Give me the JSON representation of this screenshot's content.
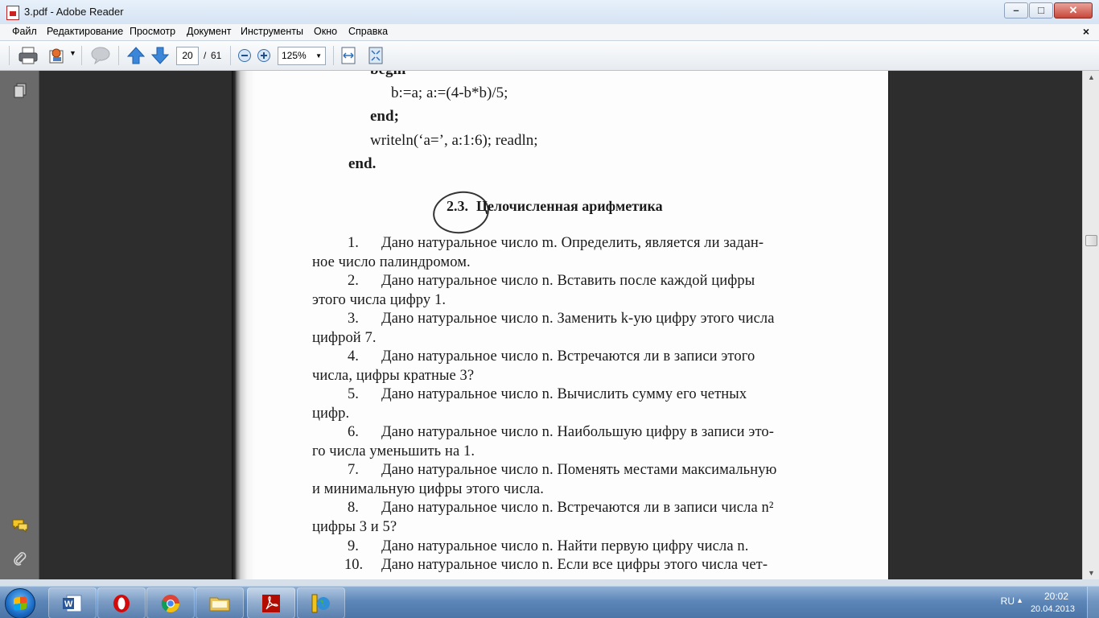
{
  "window": {
    "title": "3.pdf - Adobe Reader",
    "minimize": "–",
    "maximize": "□",
    "close": "✕"
  },
  "menu": {
    "items": [
      "Файл",
      "Редактирование",
      "Просмотр",
      "Документ",
      "Инструменты",
      "Окно",
      "Справка"
    ],
    "close_doc": "×"
  },
  "toolbar": {
    "current_page": "20",
    "page_separator": "/",
    "total_pages": "61",
    "zoom": "125%"
  },
  "document": {
    "code_lines": [
      "begin",
      "b:=a; a:=(4-b*b)/5;",
      "end;",
      "writeln(‘a=’, a:1:6); readln;",
      "end."
    ],
    "section_number": "2.3.",
    "section_title": "Целочисленная арифметика",
    "tasks": [
      {
        "num": "1.",
        "lines": [
          "Дано натуральное число m. Определить, является ли задан-",
          "ное число палиндромом."
        ]
      },
      {
        "num": "2.",
        "lines": [
          "Дано натуральное число n. Вставить после каждой цифры",
          "этого числа цифру 1."
        ]
      },
      {
        "num": "3.",
        "lines": [
          "Дано натуральное число n. Заменить k-ую цифру этого числа",
          "цифрой 7."
        ]
      },
      {
        "num": "4.",
        "lines": [
          "Дано натуральное число n. Встречаются ли в записи этого",
          "числа, цифры кратные 3?"
        ]
      },
      {
        "num": "5.",
        "lines": [
          "Дано натуральное число n. Вычислить сумму его четных",
          "цифр."
        ]
      },
      {
        "num": "6.",
        "lines": [
          "Дано натуральное число n. Наибольшую цифру в записи это-",
          "го числа уменьшить на 1."
        ]
      },
      {
        "num": "7.",
        "lines": [
          "Дано натуральное число n. Поменять местами максимальную",
          "и минимальную цифры этого числа."
        ]
      },
      {
        "num": "8.",
        "lines": [
          "Дано натуральное число n. Встречаются ли в записи числа n²",
          "цифры 3 и 5?"
        ]
      },
      {
        "num": "9.",
        "lines": [
          "Дано натуральное число n. Найти первую цифру числа n."
        ]
      },
      {
        "num": "10.",
        "lines": [
          "Дано натуральное число n. Если все цифры этого числа чет-"
        ]
      }
    ]
  },
  "taskbar": {
    "apps": [
      "word-icon",
      "opera-icon",
      "chrome-icon",
      "explorer-icon",
      "adobe-reader-icon",
      "globe-app-icon"
    ],
    "language": "RU",
    "time": "20:02",
    "date": "20.04.2013"
  }
}
